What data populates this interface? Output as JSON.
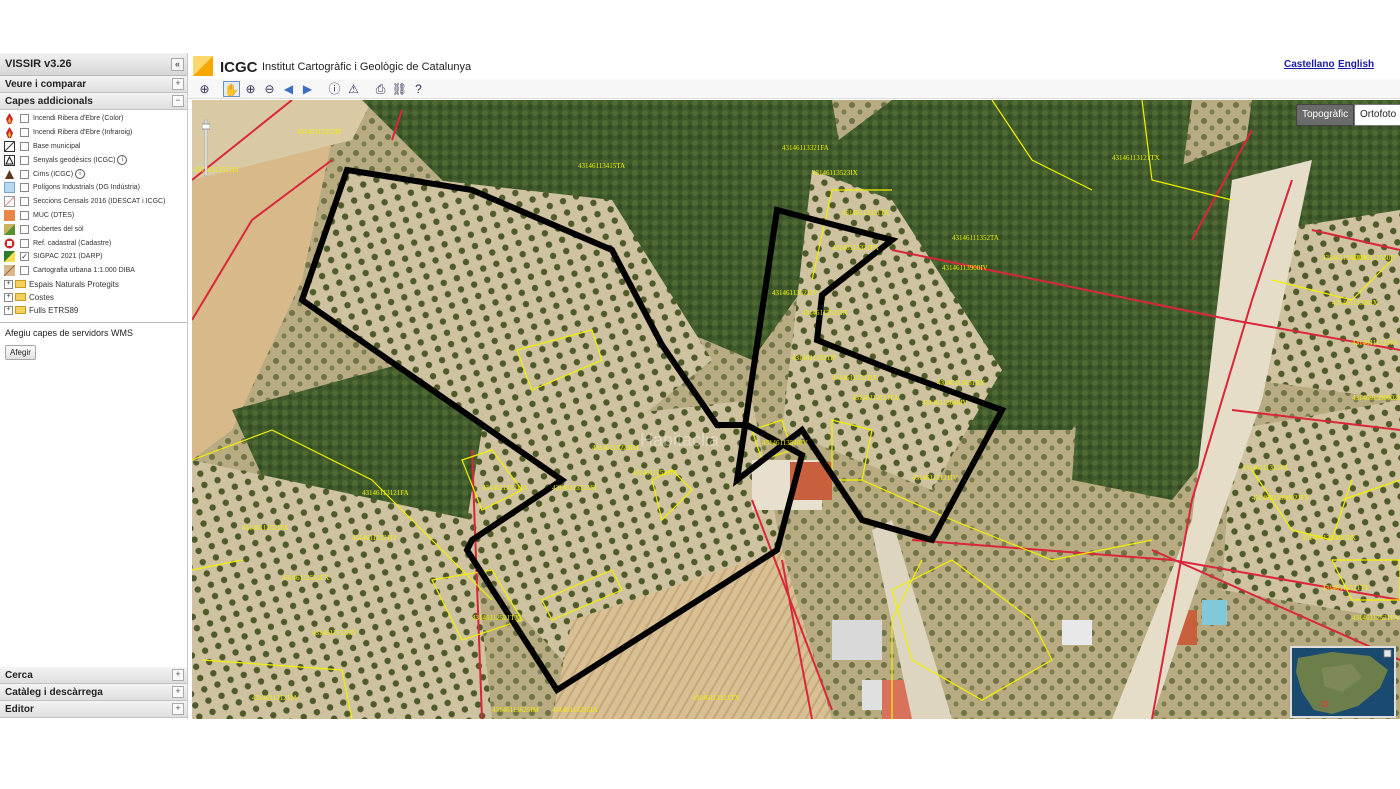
{
  "app": {
    "title": "VISSIR v3.26"
  },
  "sidebar": {
    "panels_top": [
      {
        "label": "Veure i comparar",
        "toggle": "+"
      },
      {
        "label": "Capes addicionals",
        "toggle": "−"
      }
    ],
    "layers": [
      {
        "label": "Incendi Ribera d'Ebre (Color)",
        "icon": "fire-icon",
        "checked": false,
        "info": false
      },
      {
        "label": "Incendi Ribera d'Ebre (Infraroig)",
        "icon": "fire-icon",
        "checked": false,
        "info": false
      },
      {
        "label": "Base municipal",
        "icon": "boundary-icon",
        "checked": false,
        "info": false
      },
      {
        "label": "Senyals geodèsics (ICGC)",
        "icon": "geodetic-icon",
        "checked": false,
        "info": true
      },
      {
        "label": "Cims (ICGC)",
        "icon": "peak-icon",
        "checked": false,
        "info": true
      },
      {
        "label": "Polígons Industrials (DG Indústria)",
        "icon": "industry-icon",
        "checked": false,
        "info": false
      },
      {
        "label": "Seccions Censals 2016 (IDESCAT i ICGC)",
        "icon": "census-icon",
        "checked": false,
        "info": false
      },
      {
        "label": "MUC (DTES)",
        "icon": "muc-icon",
        "checked": false,
        "info": false
      },
      {
        "label": "Cobertes del sòl",
        "icon": "landcover-icon",
        "checked": false,
        "info": false
      },
      {
        "label": "Ref. cadastral (Cadastre)",
        "icon": "cadastre-icon",
        "checked": false,
        "info": false
      },
      {
        "label": "SIGPAC 2021 (DARP)",
        "icon": "sigpac-icon",
        "checked": true,
        "info": false
      },
      {
        "label": "Cartografia urbana 1:1.000 DIBA",
        "icon": "urban-icon",
        "checked": false,
        "info": false
      }
    ],
    "folders": [
      "Espais Naturals Protegits",
      "Costes",
      "Fulls ETRS89"
    ],
    "wms": {
      "label": "Afegiu capes de servidors WMS",
      "button": "Afegir"
    },
    "panels_bottom": [
      {
        "label": "Cerca",
        "toggle": "+"
      },
      {
        "label": "Catàleg i descàrrega",
        "toggle": "+"
      },
      {
        "label": "Editor",
        "toggle": "+"
      }
    ],
    "collapse": "«"
  },
  "header": {
    "brand": "ICGC",
    "subtitle": "Institut Cartogràfic i Geològic de Catalunya",
    "lang_es": "Castellano",
    "lang_en": "English"
  },
  "toolbar": {
    "icons": [
      "zoom-extent-icon",
      "pan-icon",
      "zoom-in-icon",
      "zoom-out-icon",
      "back-icon",
      "forward-icon",
      "info-icon",
      "warning-icon",
      "print-icon",
      "link-icon",
      "help-icon"
    ]
  },
  "map": {
    "buttons": {
      "topo": "Topogràfic",
      "orto": "Ortofoto"
    },
    "parcel_labels": [
      "43146112521IS",
      "43146113352IP",
      "43146113415TA",
      "43146113321FA",
      "43146113523IX",
      "43146113321TA",
      "43146113321FA",
      "43146111352TA",
      "43146113521IV",
      "43146113521IN",
      "43146113521IP",
      "43146113521IX",
      "43146113121TX",
      "43146113640IV",
      "43146113320IX",
      "43146111321FA",
      "43146113900IV",
      "43146113651RX",
      "43146113640IV",
      "43146113121FA",
      "43146113540IV",
      "43146112521IA",
      "43146113223IM",
      "43146113121SI",
      "43146112521IA",
      "43146113121FA",
      "43146112521IV",
      "43146112521FA",
      "43146112521FX",
      "43146112521TX",
      "43146113121TX",
      "43146113215IA",
      "43146111525IV",
      "43146113121IA",
      "43146113625IM",
      "43146111321TV",
      "43146913900021FV",
      "43146913900030X",
      "43146913900028R",
      "43146113530IV",
      "43146111321FA",
      "43146113121IV",
      "43146112521FA"
    ],
    "watermark": "Habitaclia",
    "colors": {
      "cadastre_red": "#d9263a",
      "sigpac_yellow": "#f0f000",
      "selection_black": "#000000",
      "button_dark": "#6b6b6b"
    }
  }
}
